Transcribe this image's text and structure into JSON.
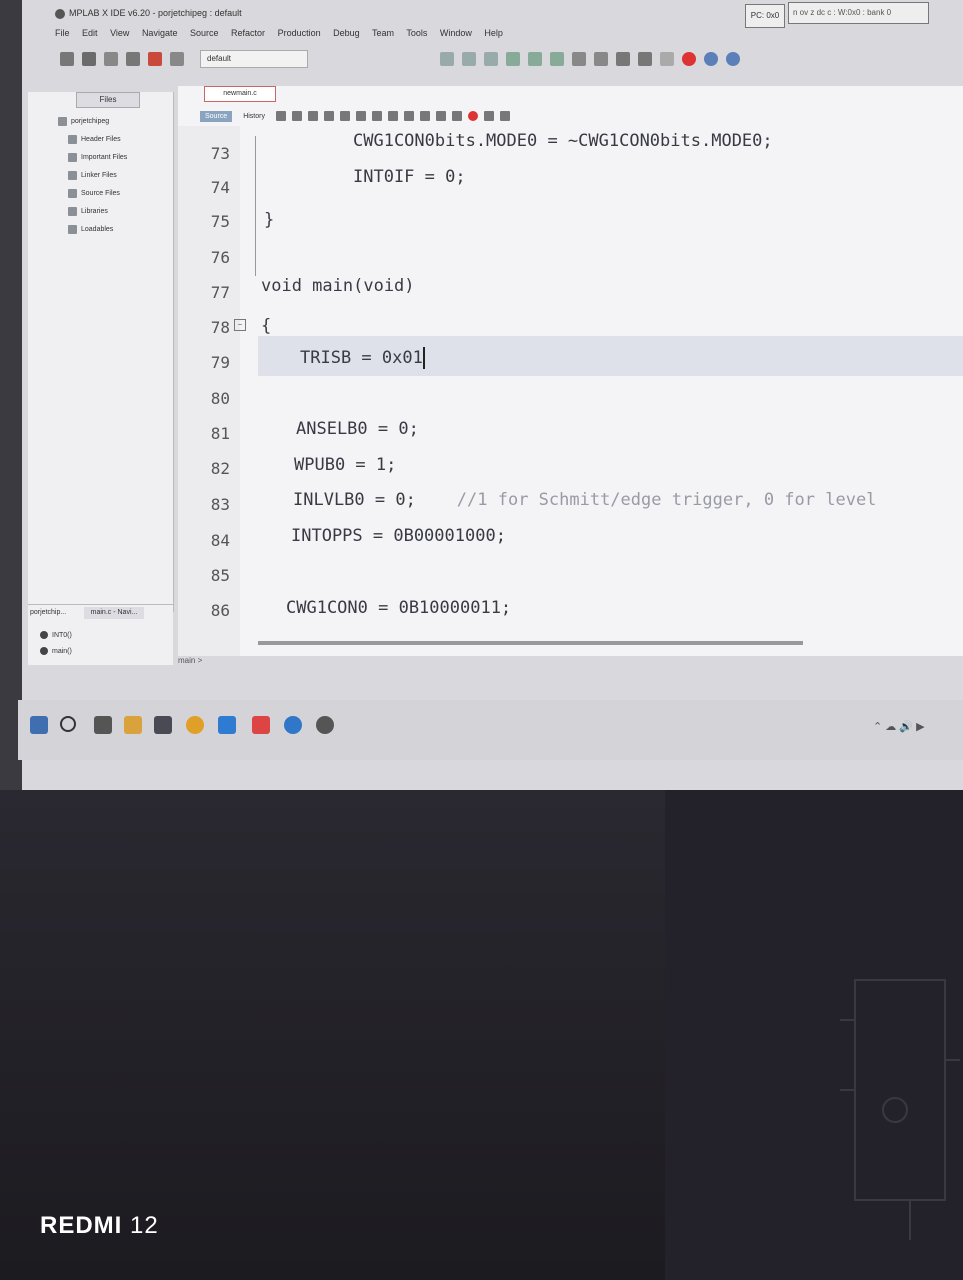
{
  "window": {
    "title": "MPLAB X IDE v6.20 - porjetchipeg : default",
    "menu": [
      "File",
      "Edit",
      "View",
      "Navigate",
      "Source",
      "Refactor",
      "Production",
      "Debug",
      "Team",
      "Tools",
      "Window",
      "Help"
    ],
    "config": "default",
    "pc_label": "PC: 0x0",
    "mem_label": "n ov z dc c : W:0x0 : bank 0"
  },
  "projects": {
    "tab_label": "Files",
    "root": "porjetchipeg",
    "folders": [
      "Header Files",
      "Important Files",
      "Linker Files",
      "Source Files",
      "Libraries",
      "Loadables"
    ]
  },
  "navigator": {
    "tab1": "porjetchip...",
    "tab2": "main.c - Navi...",
    "items": [
      "INT0()",
      "main()"
    ]
  },
  "editor": {
    "file_tab": "newmain.c",
    "source_tab": "Source",
    "history_tab": "History",
    "lines": [
      {
        "num": "73",
        "code": "CWG1CON0bits.MODE0 = ~CWG1CON0bits.MODE0;",
        "comment": ""
      },
      {
        "num": "74",
        "code": "INT0IF = 0;",
        "comment": ""
      },
      {
        "num": "75",
        "code": "}",
        "comment": ""
      },
      {
        "num": "76",
        "code": "",
        "comment": ""
      },
      {
        "num": "77",
        "code": "void main(void)",
        "comment": ""
      },
      {
        "num": "78",
        "code": "{",
        "comment": ""
      },
      {
        "num": "79",
        "code": "TRISB = 0x01",
        "comment": ""
      },
      {
        "num": "80",
        "code": "",
        "comment": ""
      },
      {
        "num": "81",
        "code": "ANSELB0 = 0;",
        "comment": ""
      },
      {
        "num": "82",
        "code": "WPUB0 = 1;",
        "comment": ""
      },
      {
        "num": "83",
        "code": "INLVLB0 = 0;",
        "comment": "//1 for Schmitt/edge trigger, 0 for level"
      },
      {
        "num": "84",
        "code": "INTOPPS = 0B00001000;",
        "comment": ""
      },
      {
        "num": "85",
        "code": "",
        "comment": ""
      },
      {
        "num": "86",
        "code": "CWG1CON0 = 0B10000011;",
        "comment": ""
      }
    ],
    "breadcrumb": "main >"
  },
  "watermark": {
    "brand": "REDMI",
    "model": "12"
  },
  "colors": {
    "screen_bg": "#d9d8dc",
    "editor_bg": "#f4f4f6",
    "highlight": "#dfe1ea",
    "desk": "#1f1d22"
  }
}
